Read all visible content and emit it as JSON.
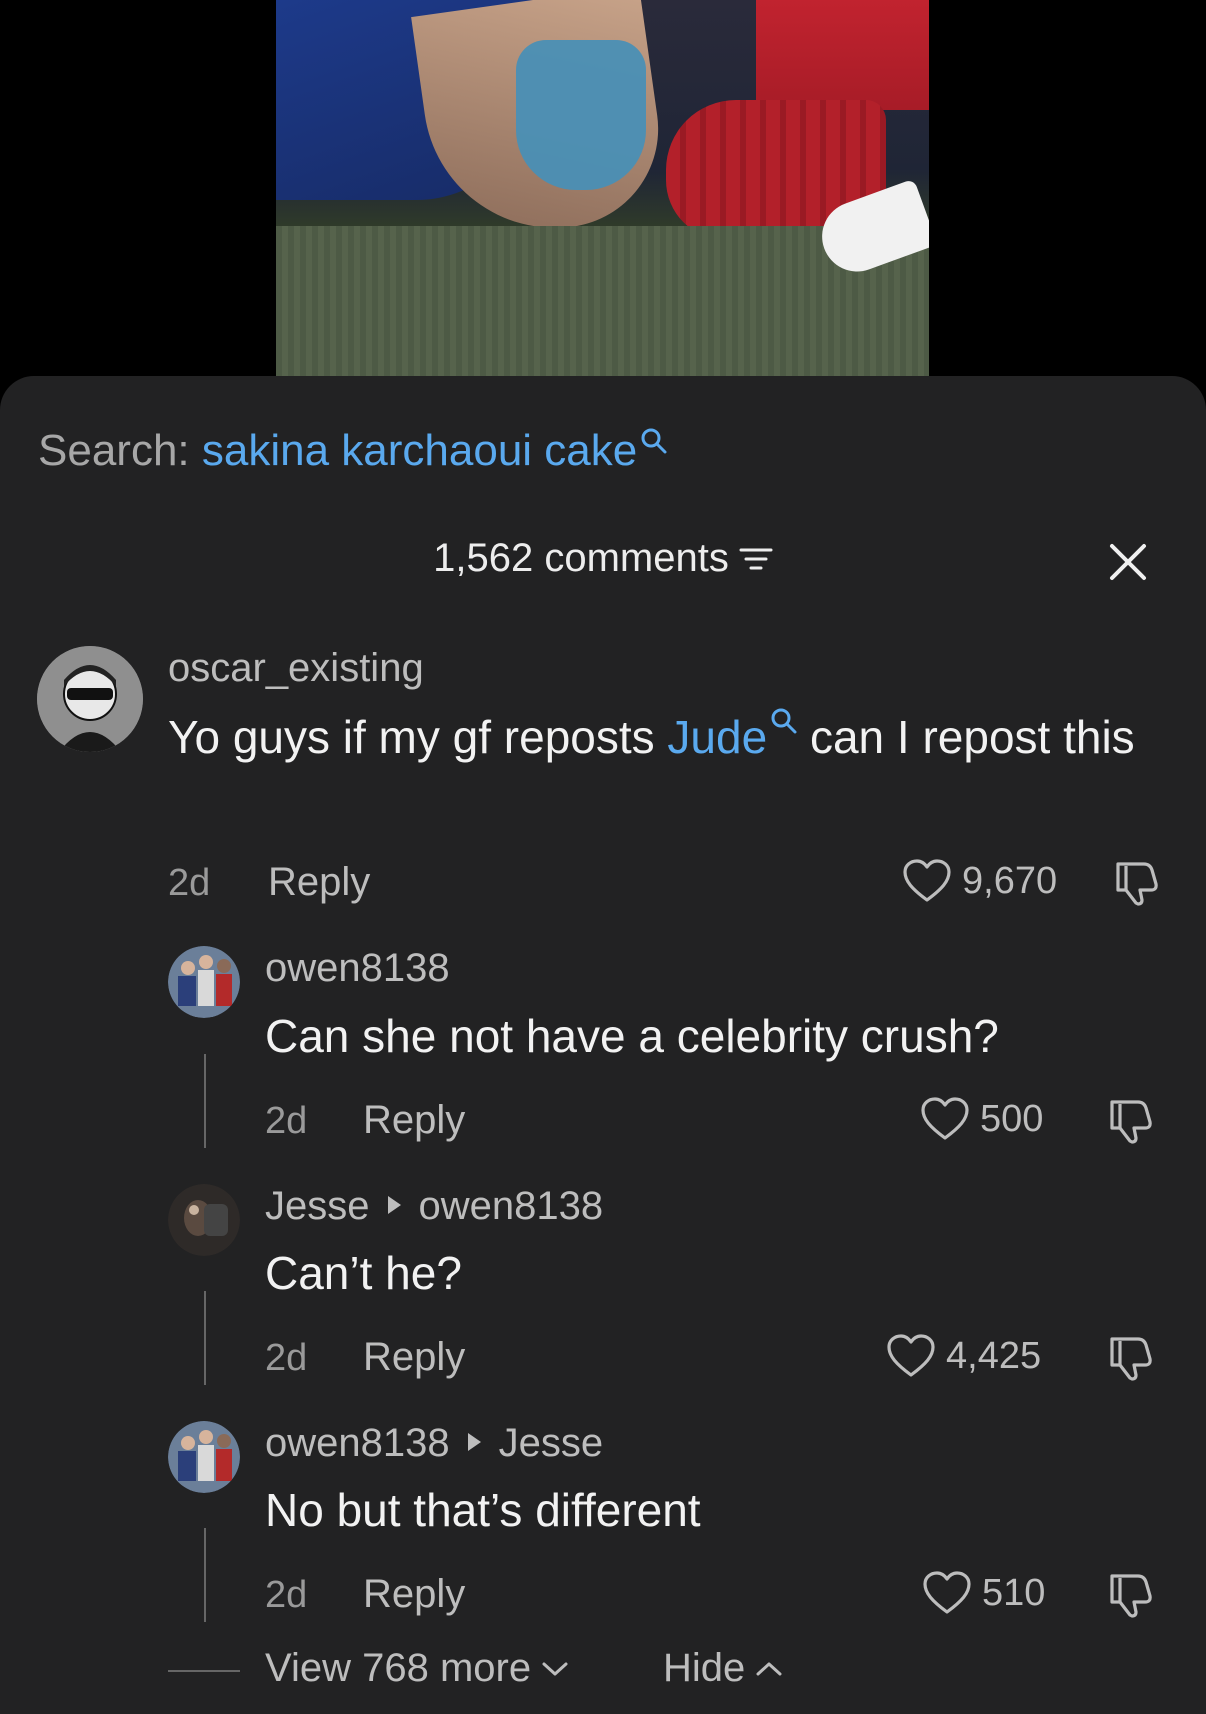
{
  "search": {
    "label": "Search:",
    "query": "sakina karchaoui cake"
  },
  "header": {
    "count_label": "1,562 comments"
  },
  "comments": [
    {
      "username": "oscar_existing",
      "text_before": "Yo guys if my gf reposts ",
      "text_link": "Jude",
      "text_after": " can I repost this",
      "time": "2d",
      "reply_label": "Reply",
      "likes": "9,670"
    },
    {
      "username": "owen8138",
      "text": "Can she not have a celebrity crush?",
      "time": "2d",
      "reply_label": "Reply",
      "likes": "500"
    },
    {
      "username": "Jesse",
      "reply_to": "owen8138",
      "text": "Can’t he?",
      "time": "2d",
      "reply_label": "Reply",
      "likes": "4,425"
    },
    {
      "username": "owen8138",
      "reply_to": "Jesse",
      "text": "No but that’s different",
      "time": "2d",
      "reply_label": "Reply",
      "likes": "510"
    }
  ],
  "footer": {
    "view_more": "View 768 more",
    "hide": "Hide"
  },
  "colors": {
    "sheet_bg": "#222223",
    "link_blue": "#5aa9ee",
    "muted": "#bdbdbd"
  }
}
